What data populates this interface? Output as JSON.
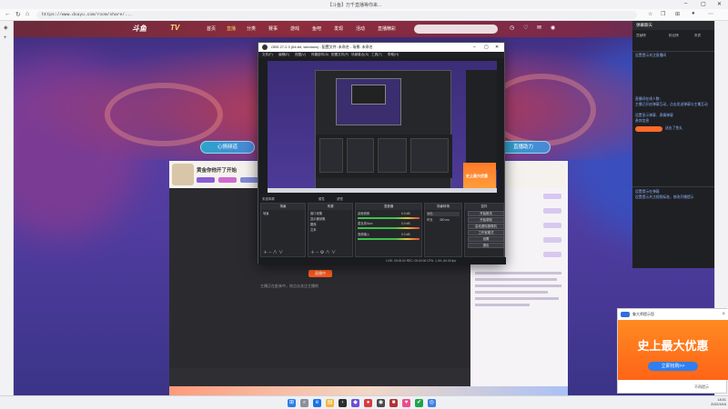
{
  "browser": {
    "tab_title": "【斗鱼】万千直播等你来...",
    "url": "https://www.douyu.com/room/share/...",
    "nav_back": "←",
    "nav_refresh": "↻",
    "nav_home": "⌂"
  },
  "site": {
    "logo": "斗鱼",
    "logo2": "TV",
    "nav_items": [
      "首页",
      "直播",
      "分类",
      "赛事",
      "游戏",
      "鱼吧",
      "发现",
      "活动",
      "直播精彩"
    ],
    "pill_left": "心情频道",
    "pill_right": "直播助力"
  },
  "stream": {
    "title": "黄金你他开了开始",
    "offline_button": "直播中",
    "offline_message": "主播正在赶来中，快点击关注主播吧"
  },
  "chat": {
    "header": "弹幕聊天",
    "tabs": [
      "贡献榜",
      "粉丝榜",
      "贵宾"
    ],
    "messages": [
      "设置提示关注直播间",
      "直播间在线人数：",
      "主播已开启弹幕互动，点击发送弹幕与主播互动",
      "设置显示弹幕、表情弹幕",
      "贵宾信息",
      "设置提示在弹幕",
      "设置提示关注视频标准，修改开播提示"
    ],
    "fire_label": "鱼丸",
    "fire_text": "送出了鱼丸"
  },
  "obs": {
    "title": "OBS 27.2.3 (64-bit, windows) - 配置文件: 未命名 - 场景: 未命名",
    "menu": [
      "文件(F)",
      "编辑(E)",
      "视图(V)",
      "停靠部件(D)",
      "配置文件(P)",
      "场景集合(S)",
      "工具(T)",
      "帮助(H)"
    ],
    "status_row": "未选择源",
    "status_buttons": [
      "属性",
      "滤镜"
    ],
    "docks": {
      "scenes": {
        "title": "场景",
        "items": [
          "场景"
        ]
      },
      "sources": {
        "title": "来源",
        "items": [
          "窗口采集",
          "显示器采集",
          "图像",
          "文本"
        ]
      },
      "mixer": {
        "title": "混音器",
        "items": [
          "桌面音频",
          "麦克风/Aux",
          "音频输入"
        ],
        "values": [
          "0.0 dB",
          "0.0 dB",
          "0.0 dB"
        ]
      },
      "transitions": {
        "title": "场景转场",
        "fade": "淡出",
        "duration_label": "时长",
        "duration_value": "300 ms"
      },
      "controls": {
        "title": "控件",
        "buttons": [
          "开始推流",
          "开始录制",
          "启动虚拟摄像机",
          "工作室模式",
          "设置",
          "退出"
        ]
      }
    },
    "footer": "LIVE: 00:00:00  REC: 00:00:00  CPU: 1.4%, 60.00 fps"
  },
  "ad": {
    "header": "鲁大师提示您",
    "close": "×",
    "headline": "史上最大优惠",
    "cta": "立即抢购>>",
    "footer": "不再提示"
  },
  "taskbar": {
    "time": "18:01",
    "date": "2022/4/16"
  },
  "colors": {
    "accent_orange": "#ff6417",
    "douyu_purple": "#5c3fa5",
    "obs_dark": "#1c1d21"
  }
}
